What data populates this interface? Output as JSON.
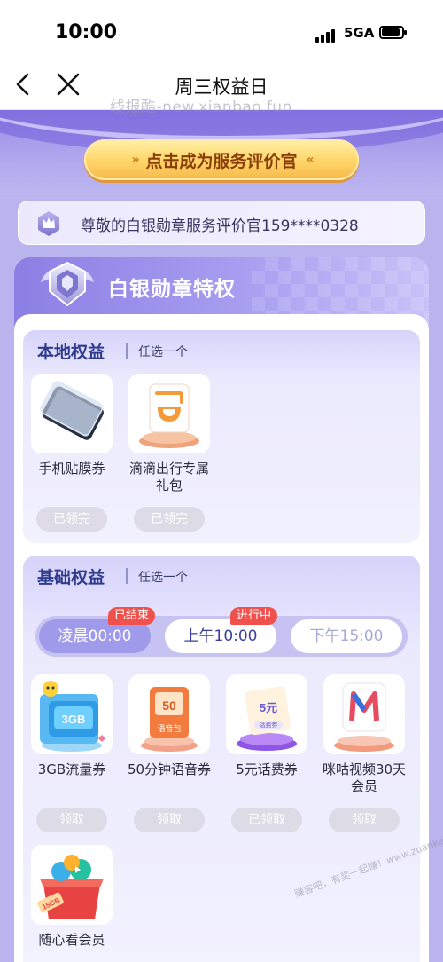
{
  "status_bar": {
    "time": "10:00",
    "network": "5GA"
  },
  "nav": {
    "title": "周三权益日",
    "watermark": "线报酷-new.xianbao.fun"
  },
  "hero": {
    "cta_label": "点击成为服务评价官",
    "cta_arrows_left": "»",
    "cta_arrows_right": "«"
  },
  "user_banner": {
    "text": "尊敬的白银勋章服务评价官159****0328"
  },
  "privilege_panel": {
    "title": "白银勋章特权"
  },
  "local_section": {
    "title": "本地权益",
    "subtitle": "任选一个",
    "items": [
      {
        "name": "手机贴膜券",
        "button": "已领完",
        "icon": "phone-screen-protector-icon"
      },
      {
        "name": "滴滴出行专属礼包",
        "button": "已领完",
        "icon": "didi-logo-icon"
      }
    ]
  },
  "basic_section": {
    "title": "基础权益",
    "subtitle": "任选一个",
    "time_tabs": [
      {
        "label": "凌晨00:00",
        "tag": "已结束"
      },
      {
        "label": "上午10:00",
        "tag": "进行中"
      },
      {
        "label": "下午15:00",
        "tag": ""
      }
    ],
    "items": [
      {
        "name": "3GB流量券",
        "button": "领取",
        "icon": "data-card-icon",
        "badge_text": "3GB"
      },
      {
        "name": "50分钟语音券",
        "button": "领取",
        "icon": "voice-pack-icon",
        "badge_text": "50",
        "sub_text": "语音包"
      },
      {
        "name": "5元话费券",
        "button": "已领取",
        "icon": "phone-bill-coupon-icon",
        "badge_text": "5元",
        "sub_text": "话费券"
      },
      {
        "name": "咪咕视频30天会员",
        "button": "领取",
        "icon": "migu-video-icon"
      },
      {
        "name": "随心看会员",
        "button": "",
        "icon": "gift-box-icon",
        "badge_text": "15GB"
      }
    ]
  },
  "watermark_bottom": "赚客吧，有奖一起赚！www.zuanke8.com",
  "colors": {
    "accent": "#2f3b8f",
    "cta_text": "#8a3d06",
    "tag_red": "#f0514c",
    "panel_purple": "#8c7fe4"
  }
}
